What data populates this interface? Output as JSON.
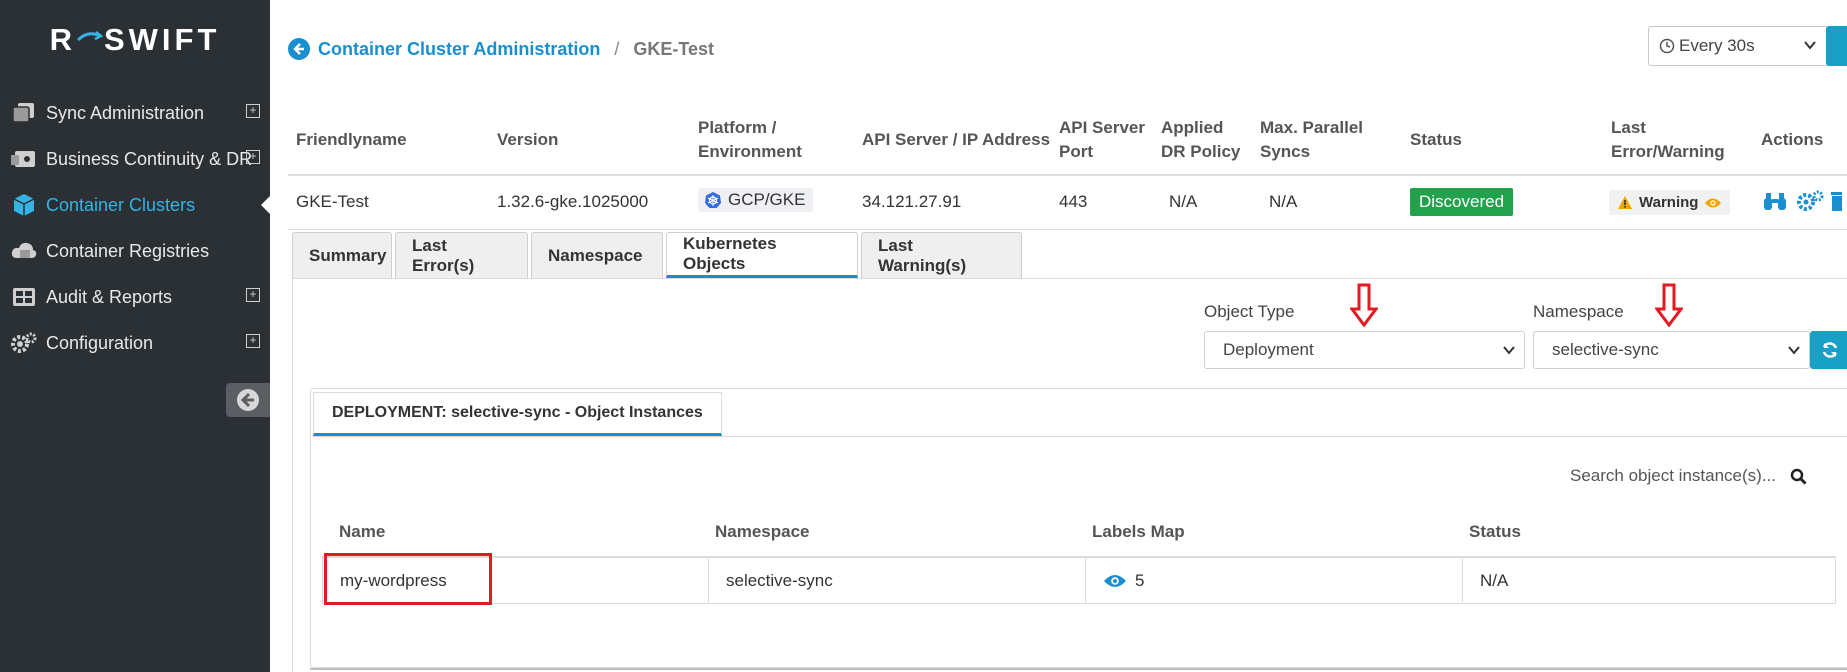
{
  "app": {
    "logo_left": "R",
    "logo_right": "SWIFT"
  },
  "sidebar": {
    "items": [
      {
        "label": "Sync Administration",
        "icon": "copy-icon",
        "expandable": true
      },
      {
        "label": "Business Continuity & DR",
        "icon": "dr-server-icon",
        "expandable": true
      },
      {
        "label": "Container Clusters",
        "icon": "cube-icon",
        "active": true
      },
      {
        "label": "Container Registries",
        "icon": "cloud-database-icon"
      },
      {
        "label": "Audit & Reports",
        "icon": "table-grid-icon",
        "expandable": true
      },
      {
        "label": "Configuration",
        "icon": "cogs-icon",
        "expandable": true
      }
    ],
    "expand_symbol": "+"
  },
  "breadcrumb": {
    "parent": "Container Cluster Administration",
    "separator": "/",
    "current": "GKE-Test"
  },
  "refresh": {
    "interval": "Every 30s"
  },
  "cluster_table": {
    "headers": {
      "friendlyname": "Friendlyname",
      "version": "Version",
      "platform_1": "Platform /",
      "platform_2": "Environment",
      "api_1": "API Server / IP Address",
      "port_1": "API Server",
      "port_2": "Port",
      "dr_1": "Applied",
      "dr_2": "DR Policy",
      "max_1": "Max. Parallel",
      "max_2": "Syncs",
      "status": "Status",
      "err_1": "Last",
      "err_2": "Error/Warning",
      "actions": "Actions"
    },
    "row": {
      "friendlyname": "GKE-Test",
      "version": "1.32.6-gke.1025000",
      "platform": "GCP/GKE",
      "api_address": "34.121.27.91",
      "port": "443",
      "dr_policy": "N/A",
      "max_syncs": "N/A",
      "status": "Discovered",
      "last_error": "Warning"
    }
  },
  "tabs": [
    {
      "label": "Summary"
    },
    {
      "label": "Last Error(s)"
    },
    {
      "label": "Namespace"
    },
    {
      "label": "Kubernetes Objects",
      "active": true
    },
    {
      "label": "Last Warning(s)"
    }
  ],
  "filters": {
    "object_type_label": "Object Type",
    "object_type_value": "Deployment",
    "namespace_label": "Namespace",
    "namespace_value": "selective-sync"
  },
  "instances_panel": {
    "title": "DEPLOYMENT: selective-sync - Object Instances",
    "search_placeholder": "Search object instance(s)...",
    "headers": {
      "name": "Name",
      "namespace": "Namespace",
      "labels": "Labels Map",
      "status": "Status"
    },
    "rows": [
      {
        "name": "my-wordpress",
        "namespace": "selective-sync",
        "labels_count": "5",
        "status": "N/A"
      }
    ]
  },
  "colors": {
    "sidebar_bg": "#2b3035",
    "accent": "#1a8fd0",
    "active_nav": "#34b3e4",
    "status_green": "#23a24d",
    "warning_yellow": "#f0a500",
    "highlight_red": "#e21b23"
  }
}
